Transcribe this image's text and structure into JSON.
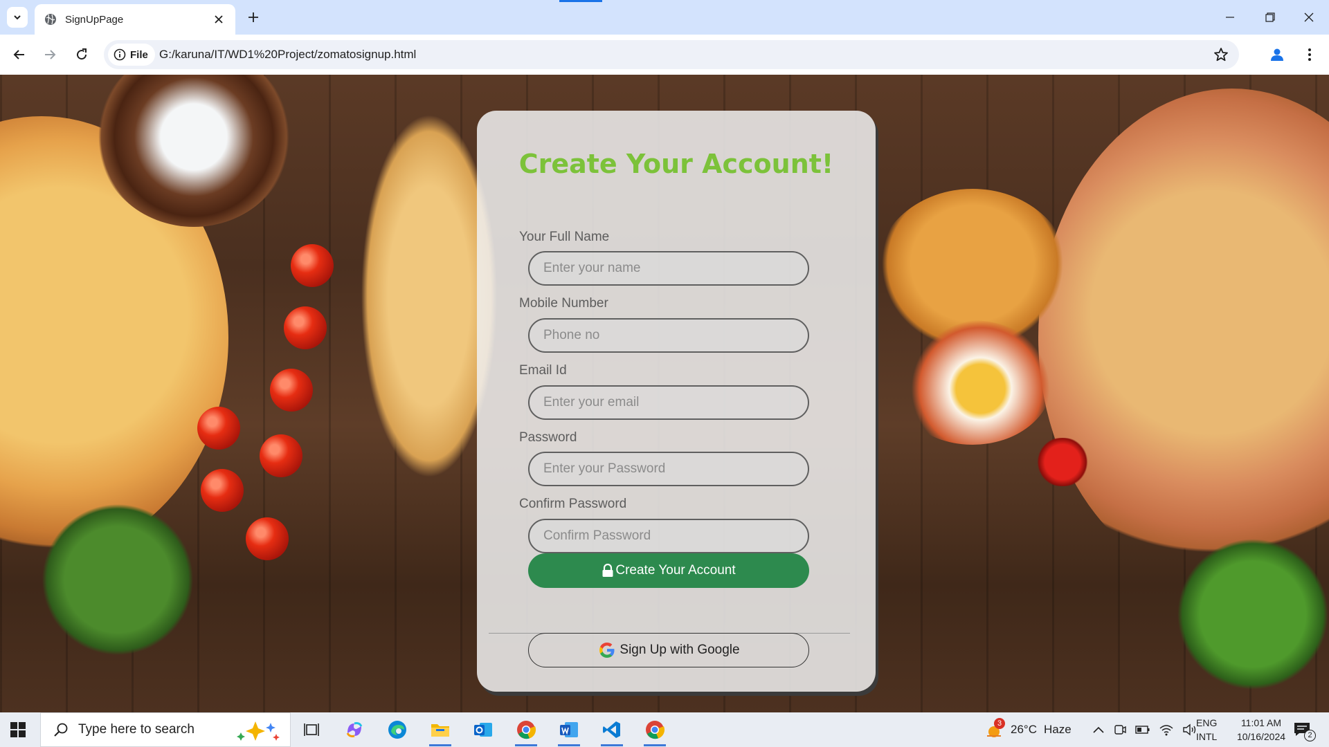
{
  "browser": {
    "tab_title": "SignUpPage",
    "site_chip_label": "File",
    "url": "G:/karuna/IT/WD1%20Project/zomatosignup.html"
  },
  "form": {
    "title": "Create Your Account!",
    "fields": [
      {
        "label": "Your Full Name",
        "placeholder": "Enter your name"
      },
      {
        "label": "Mobile Number",
        "placeholder": "Phone no"
      },
      {
        "label": "Email Id",
        "placeholder": "Enter your email"
      },
      {
        "label": "Password",
        "placeholder": "Enter your Password"
      },
      {
        "label": "Confirm Password",
        "placeholder": "Confirm Password"
      }
    ],
    "submit_label": "Create Your Account",
    "google_label": "Sign Up with Google"
  },
  "colors": {
    "title_green": "#7cc23a",
    "button_green": "#2d8a4e"
  },
  "taskbar": {
    "search_placeholder": "Type here to search",
    "weather_badge": "3",
    "weather_temp": "26°C",
    "weather_desc": "Haze",
    "lang_line1": "ENG",
    "lang_line2": "INTL",
    "time": "11:01 AM",
    "date": "10/16/2024",
    "notification_count": "2"
  }
}
